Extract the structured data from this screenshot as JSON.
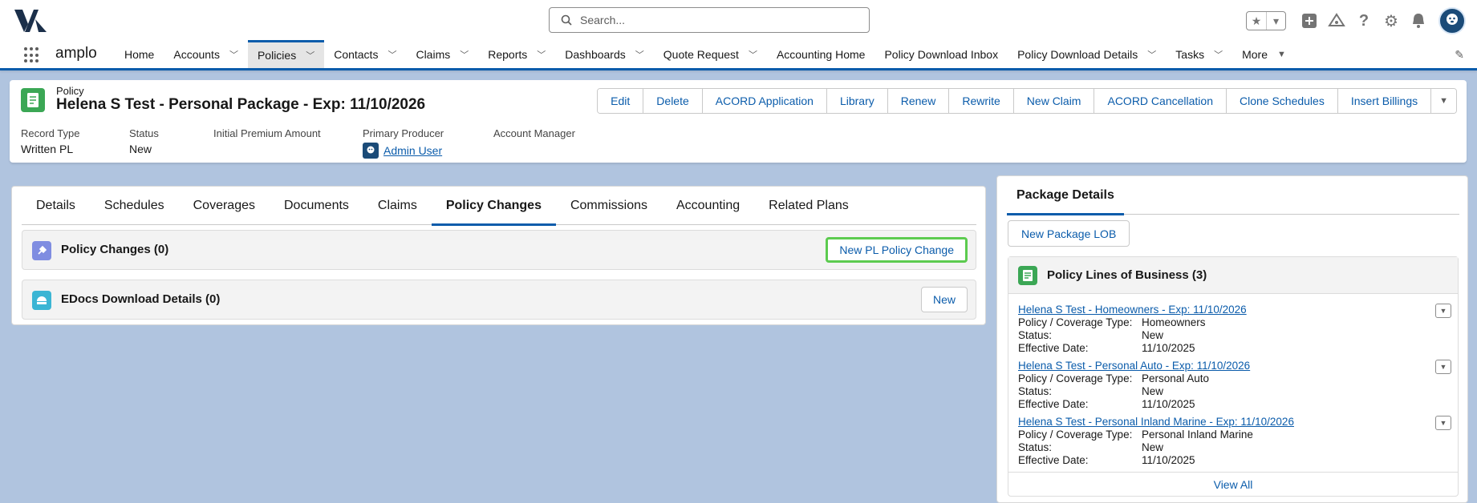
{
  "topbar": {
    "search_placeholder": "Search...",
    "fav_icon": "star-icon",
    "icons": [
      "add-icon",
      "trailhead-icon",
      "help-icon",
      "setup-gear-icon",
      "notifications-bell-icon"
    ]
  },
  "nav": {
    "app_name": "amplo",
    "items": [
      {
        "label": "Home",
        "chevron": false
      },
      {
        "label": "Accounts",
        "chevron": true
      },
      {
        "label": "Policies",
        "chevron": true,
        "active": true
      },
      {
        "label": "Contacts",
        "chevron": true
      },
      {
        "label": "Claims",
        "chevron": true
      },
      {
        "label": "Reports",
        "chevron": true
      },
      {
        "label": "Dashboards",
        "chevron": true
      },
      {
        "label": "Quote Request",
        "chevron": true
      },
      {
        "label": "Accounting Home",
        "chevron": false
      },
      {
        "label": "Policy Download Inbox",
        "chevron": false
      },
      {
        "label": "Policy Download Details",
        "chevron": true
      },
      {
        "label": "Tasks",
        "chevron": true
      },
      {
        "label": "More",
        "chevron": true
      }
    ]
  },
  "record": {
    "object_type": "Policy",
    "title": "Helena S Test - Personal Package - Exp: 11/10/2026",
    "actions": [
      "Edit",
      "Delete",
      "ACORD Application",
      "Library",
      "Renew",
      "Rewrite",
      "New Claim",
      "ACORD Cancellation",
      "Clone Schedules",
      "Insert Billings"
    ],
    "fields": [
      {
        "label": "Record Type",
        "value": "Written PL"
      },
      {
        "label": "Status",
        "value": "New"
      },
      {
        "label": "Initial Premium Amount",
        "value": ""
      },
      {
        "label": "Primary Producer",
        "value": "Admin User",
        "link": true
      },
      {
        "label": "Account Manager",
        "value": ""
      }
    ]
  },
  "tabs": [
    "Details",
    "Schedules",
    "Coverages",
    "Documents",
    "Claims",
    "Policy Changes",
    "Commissions",
    "Accounting",
    "Related Plans"
  ],
  "active_tab": "Policy Changes",
  "related_lists": {
    "policy_changes": {
      "title": "Policy Changes (0)",
      "button": "New PL Policy Change",
      "icon_color": "#7f8de1"
    },
    "edocs": {
      "title": "EDocs Download Details (0)",
      "button": "New",
      "icon_color": "#3bb5d4"
    }
  },
  "side": {
    "tab": "Package Details",
    "button": "New Package LOB",
    "lob_title": "Policy Lines of Business (3)",
    "labels": {
      "type": "Policy / Coverage Type:",
      "status": "Status:",
      "effective": "Effective Date:"
    },
    "items": [
      {
        "name": "Helena S Test - Homeowners - Exp: 11/10/2026",
        "type": "Homeowners",
        "status": "New",
        "effective": "11/10/2025"
      },
      {
        "name": "Helena S Test - Personal Auto - Exp: 11/10/2026",
        "type": "Personal Auto",
        "status": "New",
        "effective": "11/10/2025"
      },
      {
        "name": "Helena S Test - Personal Inland Marine - Exp: 11/10/2026",
        "type": "Personal Inland Marine",
        "status": "New",
        "effective": "11/10/2025"
      }
    ],
    "view_all": "View All"
  },
  "colors": {
    "brand_blue": "#0b5cab",
    "policy_green": "#3ba755",
    "highlight_green": "#5ccb4f"
  }
}
